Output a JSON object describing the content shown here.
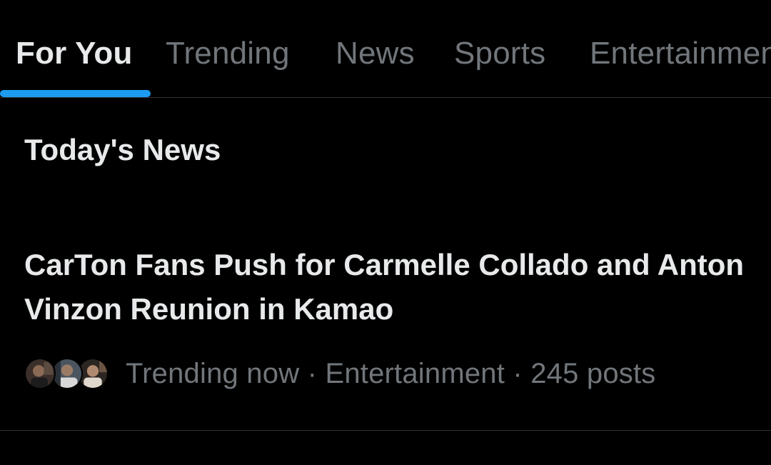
{
  "tabs": [
    {
      "label": "For You",
      "active": true
    },
    {
      "label": "Trending",
      "active": false
    },
    {
      "label": "News",
      "active": false
    },
    {
      "label": "Sports",
      "active": false
    },
    {
      "label": "Entertainment",
      "active": false
    }
  ],
  "section": {
    "title": "Today's News"
  },
  "news_item": {
    "headline": "CarTon Fans Push for Carmelle Collado and Anton Vinzon Reunion in Kamao",
    "status": "Trending now",
    "category": "Entertainment",
    "post_count": "245 posts",
    "separator": " · "
  },
  "colors": {
    "background": "#000000",
    "primary_text": "#e7e9ea",
    "secondary_text": "#71767b",
    "accent": "#1d9bf0",
    "divider": "#2f3336"
  }
}
